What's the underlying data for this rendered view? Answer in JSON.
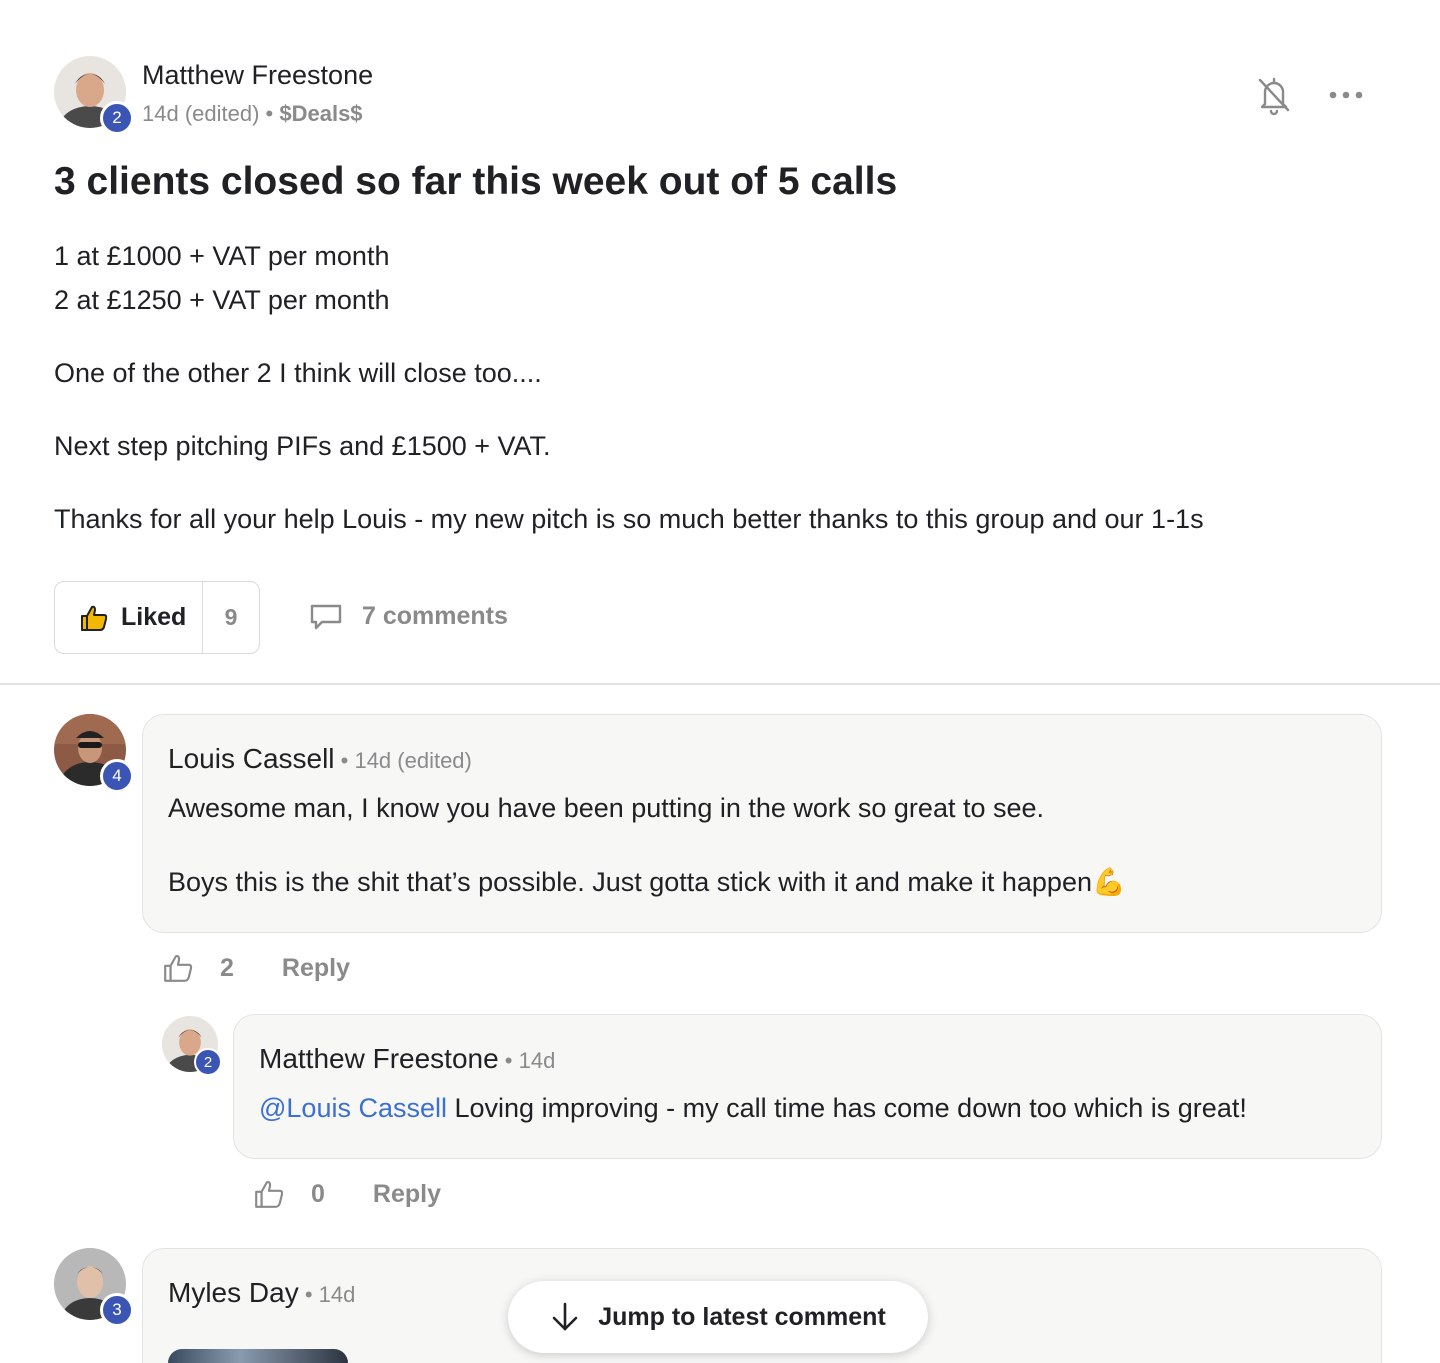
{
  "post": {
    "author": "Matthew Freestone",
    "author_level": "2",
    "time": "14d (edited)",
    "separator": " • ",
    "category": "$Deals$",
    "title": "3 clients closed so far this week out of 5 calls",
    "body": {
      "line1": "1 at £1000 + VAT per month",
      "line2": "2 at £1250 + VAT per month",
      "para2": "One of the other 2 I think will close too....",
      "para3": "Next step pitching PIFs and £1500 + VAT.",
      "para4": "Thanks for all your help Louis - my new pitch is so much better thanks to this group and our 1-1s"
    },
    "like_label": "Liked",
    "like_count": "9",
    "comments_label": "7 comments"
  },
  "icons": {
    "bell": "bell-off-icon",
    "more": "more-horizontal-icon",
    "like": "thumbs-up-icon",
    "comment": "comment-bubble-icon",
    "arrow": "arrow-down-icon"
  },
  "comments": [
    {
      "author": "Louis Cassell",
      "level": "4",
      "meta": " • 14d (edited)",
      "text1": "Awesome man, I know you have been putting in the work so great to see.",
      "text2": "Boys this is the shit that’s possible. Just gotta stick with it and make it happen💪",
      "likes": "2",
      "reply_label": "Reply"
    },
    {
      "author": "Matthew Freestone",
      "level": "2",
      "meta": " • 14d",
      "mention": "@Louis Cassell",
      "text": " Loving improving - my call time has come down too which is great!",
      "likes": "0",
      "reply_label": "Reply"
    },
    {
      "author": "Myles Day",
      "level": "3",
      "meta": " • 14d"
    }
  ],
  "jump_button": "Jump to latest comment",
  "colors": {
    "badge": "#3b55b5",
    "mention": "#3b6fd1",
    "muted": "#8a8a8a"
  }
}
